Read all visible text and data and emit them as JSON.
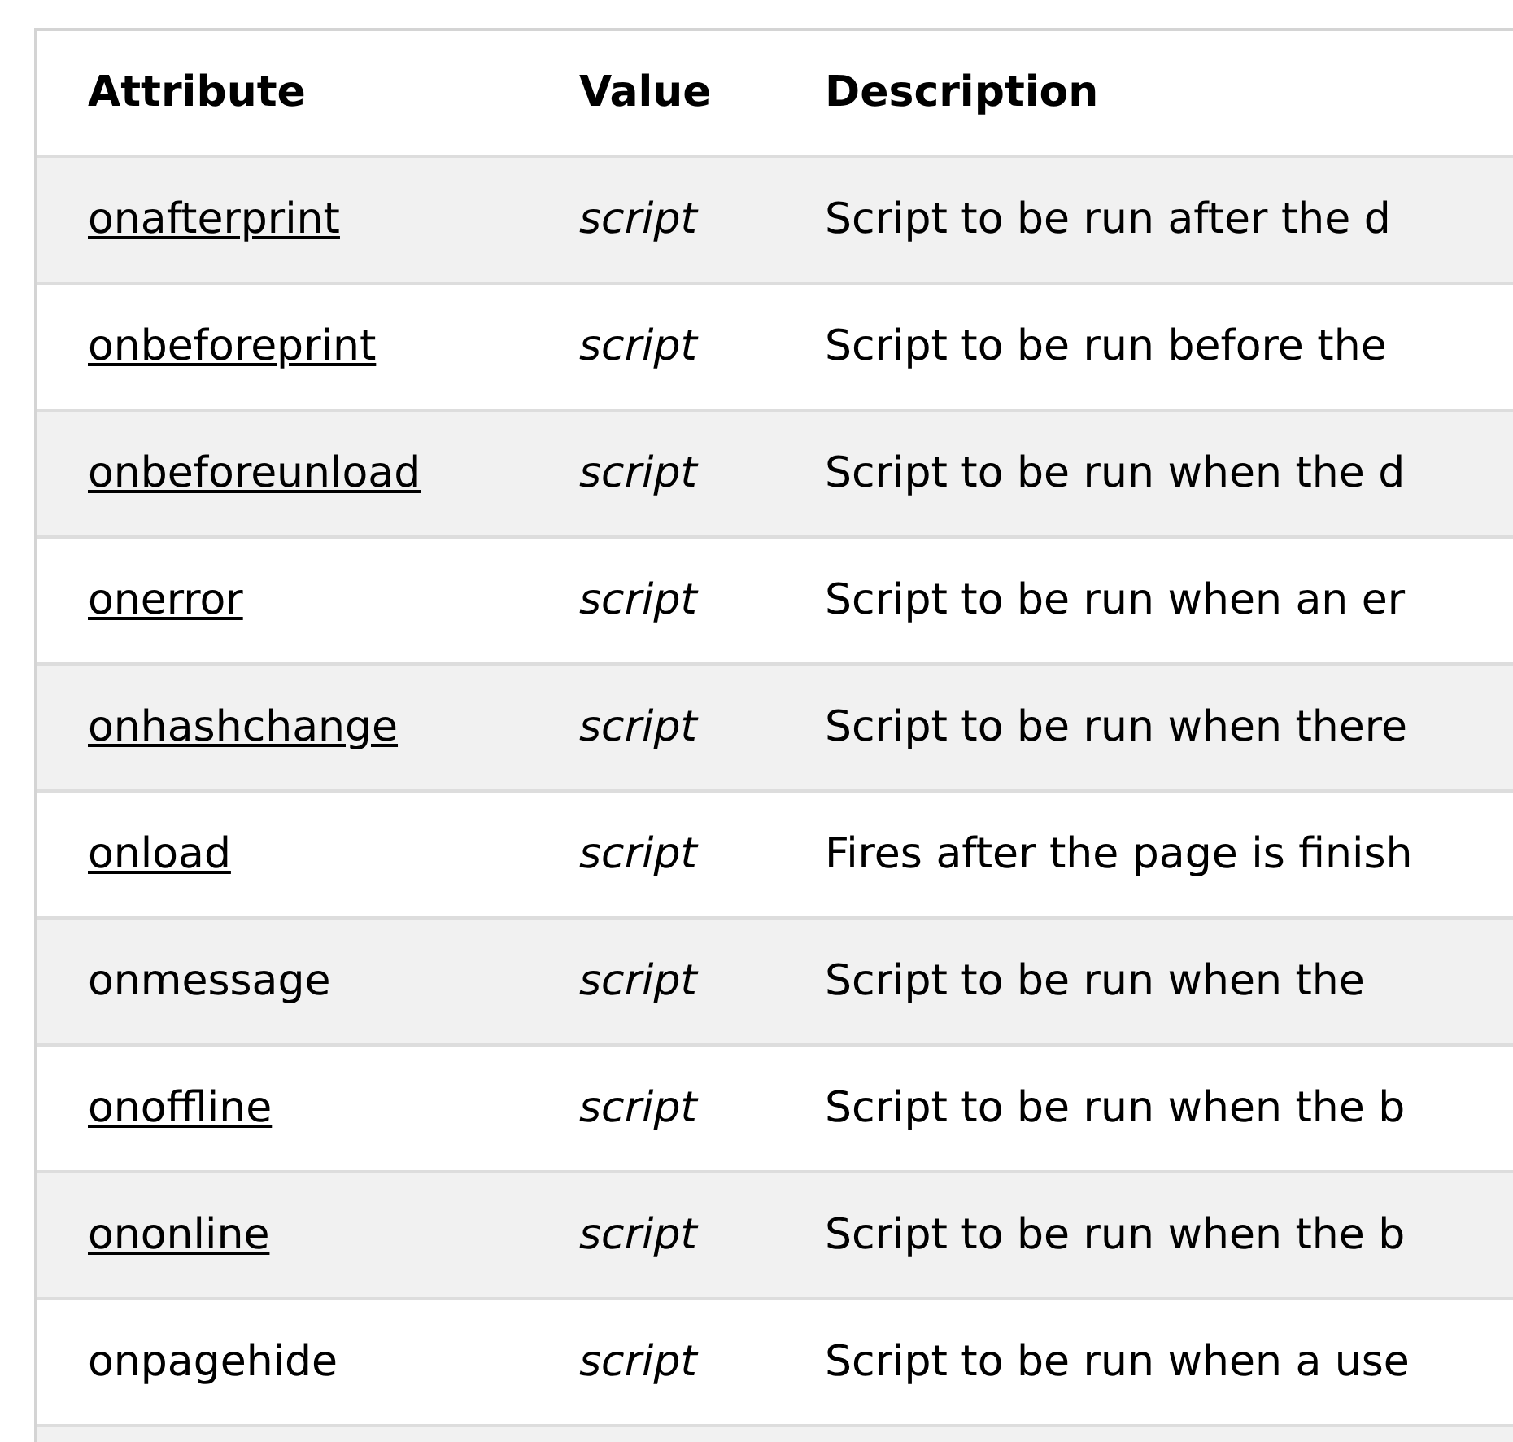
{
  "table": {
    "columns": [
      "Attribute",
      "Value",
      "Description"
    ],
    "rows": [
      {
        "attribute": "onafterprint",
        "link": true,
        "value": "script",
        "description": "Script to be run after the d"
      },
      {
        "attribute": "onbeforeprint",
        "link": true,
        "value": "script",
        "description": "Script to be run before the"
      },
      {
        "attribute": "onbeforeunload",
        "link": true,
        "value": "script",
        "description": "Script to be run when the d"
      },
      {
        "attribute": "onerror",
        "link": true,
        "value": "script",
        "description": "Script to be run when an er"
      },
      {
        "attribute": "onhashchange",
        "link": true,
        "value": "script",
        "description": "Script to be run when there"
      },
      {
        "attribute": "onload",
        "link": true,
        "value": "script",
        "description": "Fires after the page is finish"
      },
      {
        "attribute": "onmessage",
        "link": false,
        "value": "script",
        "description": "Script to be run when the"
      },
      {
        "attribute": "onoffline",
        "link": true,
        "value": "script",
        "description": "Script to be run when the b"
      },
      {
        "attribute": "ononline",
        "link": true,
        "value": "script",
        "description": "Script to be run when the b"
      },
      {
        "attribute": "onpagehide",
        "link": false,
        "value": "script",
        "description": "Script to be run when a use"
      }
    ]
  }
}
